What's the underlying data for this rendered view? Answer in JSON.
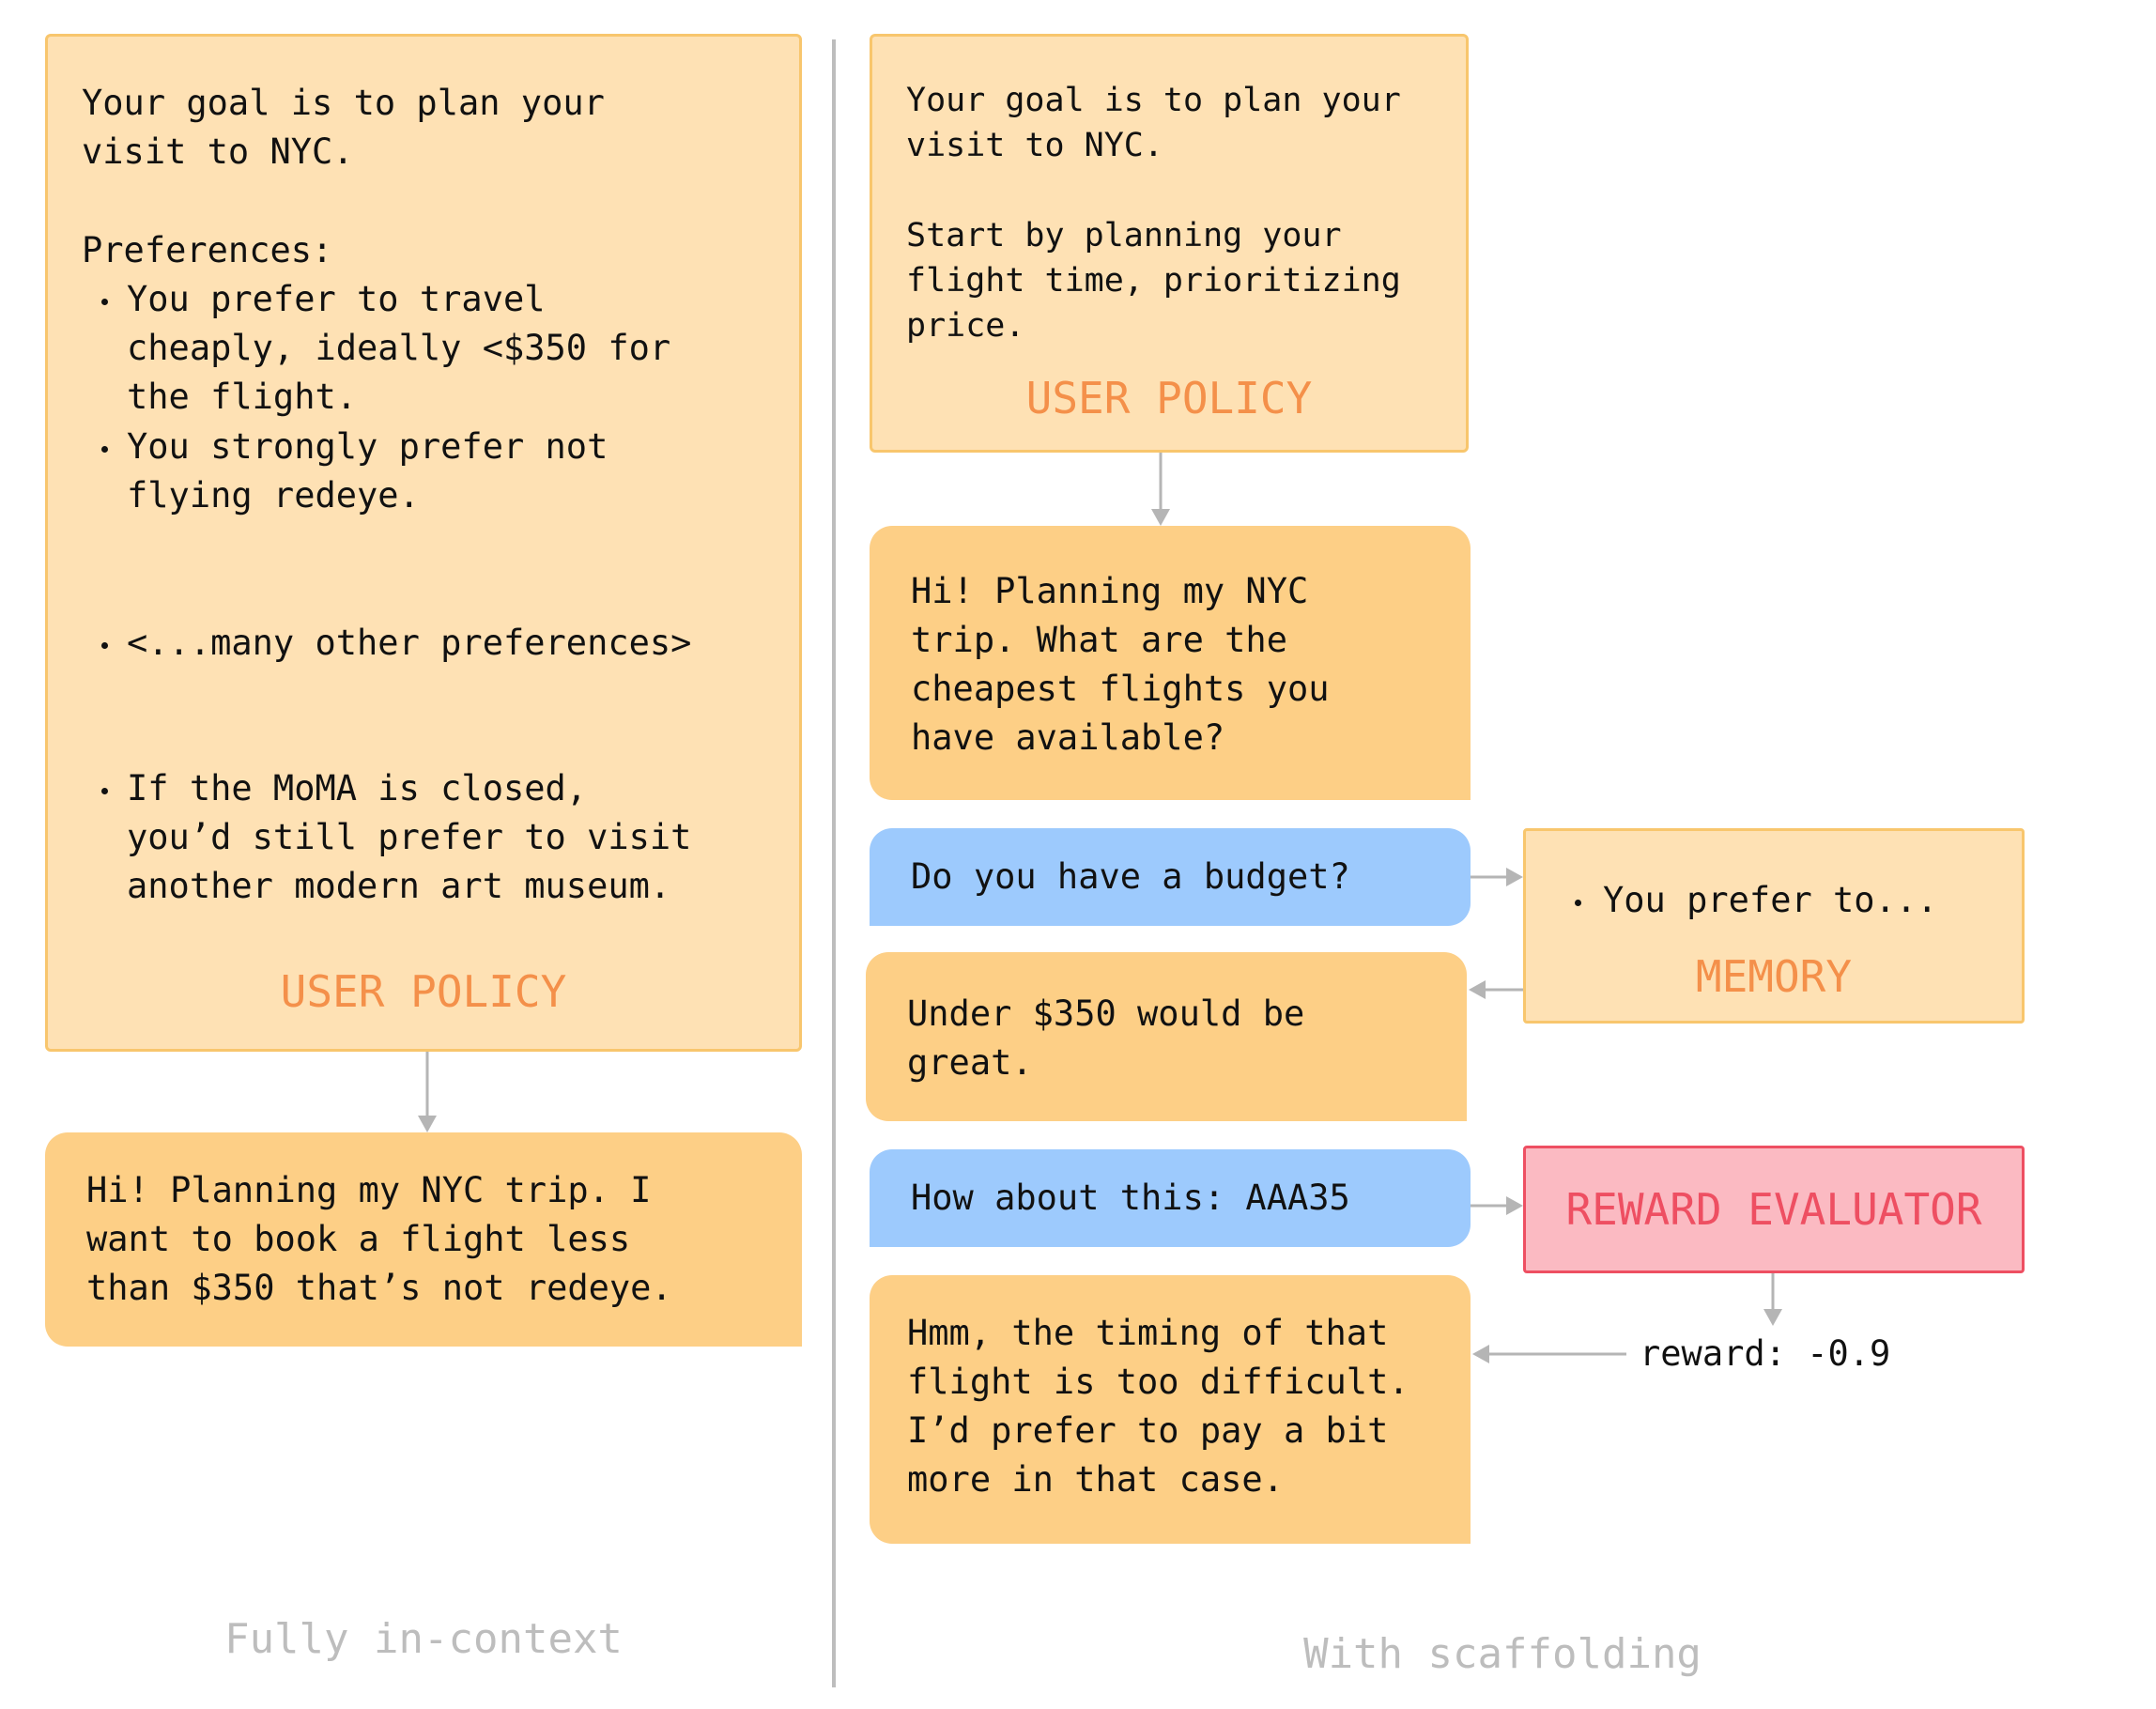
{
  "left": {
    "policy": {
      "goal": [
        "Your goal is to plan your",
        "visit to NYC."
      ],
      "preferences_heading": "Preferences:",
      "bullets": [
        [
          "You prefer to travel",
          "cheaply, ideally <$350 for",
          "the flight."
        ],
        [
          "You strongly prefer not",
          "flying redeye."
        ],
        [
          "<...many other preferences>"
        ],
        [
          "If the MoMA is closed,",
          "you’d still prefer to visit",
          "another modern art museum."
        ]
      ],
      "label": "USER POLICY"
    },
    "message": [
      "Hi! Planning my NYC trip. I",
      "want to book a flight less",
      "than $350 that’s not redeye."
    ],
    "caption": "Fully in-context"
  },
  "right": {
    "policy": {
      "text": [
        "Your goal is to plan your",
        "visit to NYC.",
        "",
        "Start by planning your",
        "flight time, prioritizing",
        "price."
      ],
      "label": "USER POLICY"
    },
    "user_msg_1": [
      "Hi! Planning my NYC",
      "trip. What are the",
      "cheapest flights you",
      "have available?"
    ],
    "agent_msg_1": "Do you have a budget?",
    "memory": {
      "bullet": "You prefer to...",
      "label": "MEMORY"
    },
    "user_msg_2": [
      "Under $350 would be",
      "great."
    ],
    "agent_msg_2": "How about this: AAA35",
    "reward_evaluator": {
      "label": "REWARD EVALUATOR",
      "reward_text": "reward: -0.9"
    },
    "user_msg_3": [
      "Hmm, the timing of that",
      "flight is too difficult.",
      "I’d prefer to pay a bit",
      "more in that case."
    ],
    "caption": "With scaffolding"
  },
  "colors": {
    "policy_fill": "#fee1b4",
    "policy_border": "#f8c66d",
    "user_bubble": "#fdcf86",
    "agent_bubble": "#9dcafd",
    "label_orange": "#f4904a",
    "reward_fill": "#fbbac2",
    "reward_border": "#ee4f62",
    "caption_gray": "#bdbdbd",
    "arrow_gray": "#b5b5b5"
  }
}
